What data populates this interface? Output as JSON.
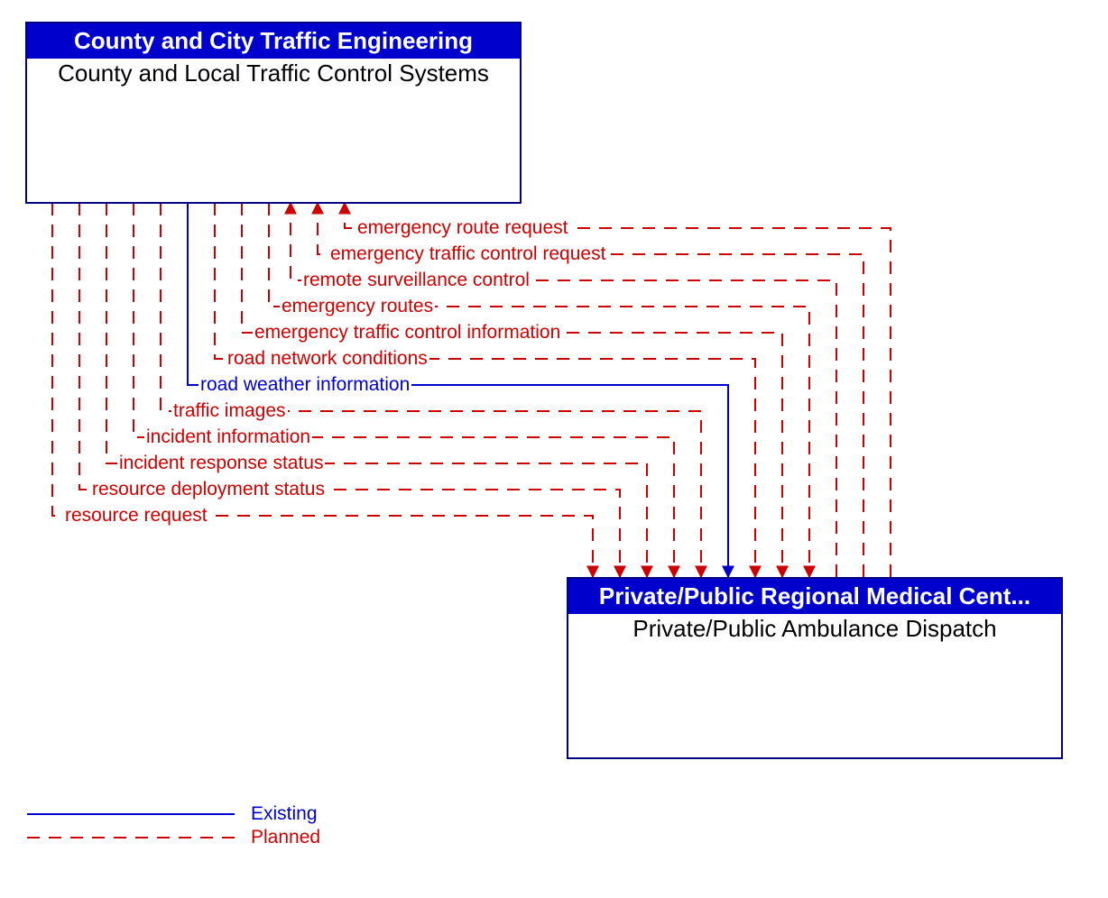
{
  "colors": {
    "existing": "#0000cc",
    "planned": "#cc0000",
    "header_bg": "#0000cc",
    "header_fg": "#ffffff",
    "body_fg": "#000000"
  },
  "box_top": {
    "header": "County and City Traffic Engineering",
    "body": "County and Local Traffic Control Systems"
  },
  "box_bottom": {
    "header": "Private/Public Regional Medical Cent...",
    "body": "Private/Public Ambulance Dispatch"
  },
  "flows_to_bottom": [
    {
      "label": "resource request",
      "status": "planned"
    },
    {
      "label": "resource deployment status",
      "status": "planned"
    },
    {
      "label": "incident response status",
      "status": "planned"
    },
    {
      "label": "incident information",
      "status": "planned"
    },
    {
      "label": "traffic images",
      "status": "planned"
    },
    {
      "label": "road weather information",
      "status": "existing"
    },
    {
      "label": "road network conditions",
      "status": "planned"
    },
    {
      "label": "emergency traffic control information",
      "status": "planned"
    },
    {
      "label": "emergency routes",
      "status": "planned"
    }
  ],
  "flows_to_top": [
    {
      "label": "remote surveillance control",
      "status": "planned"
    },
    {
      "label": "emergency traffic control request",
      "status": "planned"
    },
    {
      "label": "emergency route request",
      "status": "planned"
    }
  ],
  "legend": {
    "existing": "Existing",
    "planned": "Planned"
  }
}
